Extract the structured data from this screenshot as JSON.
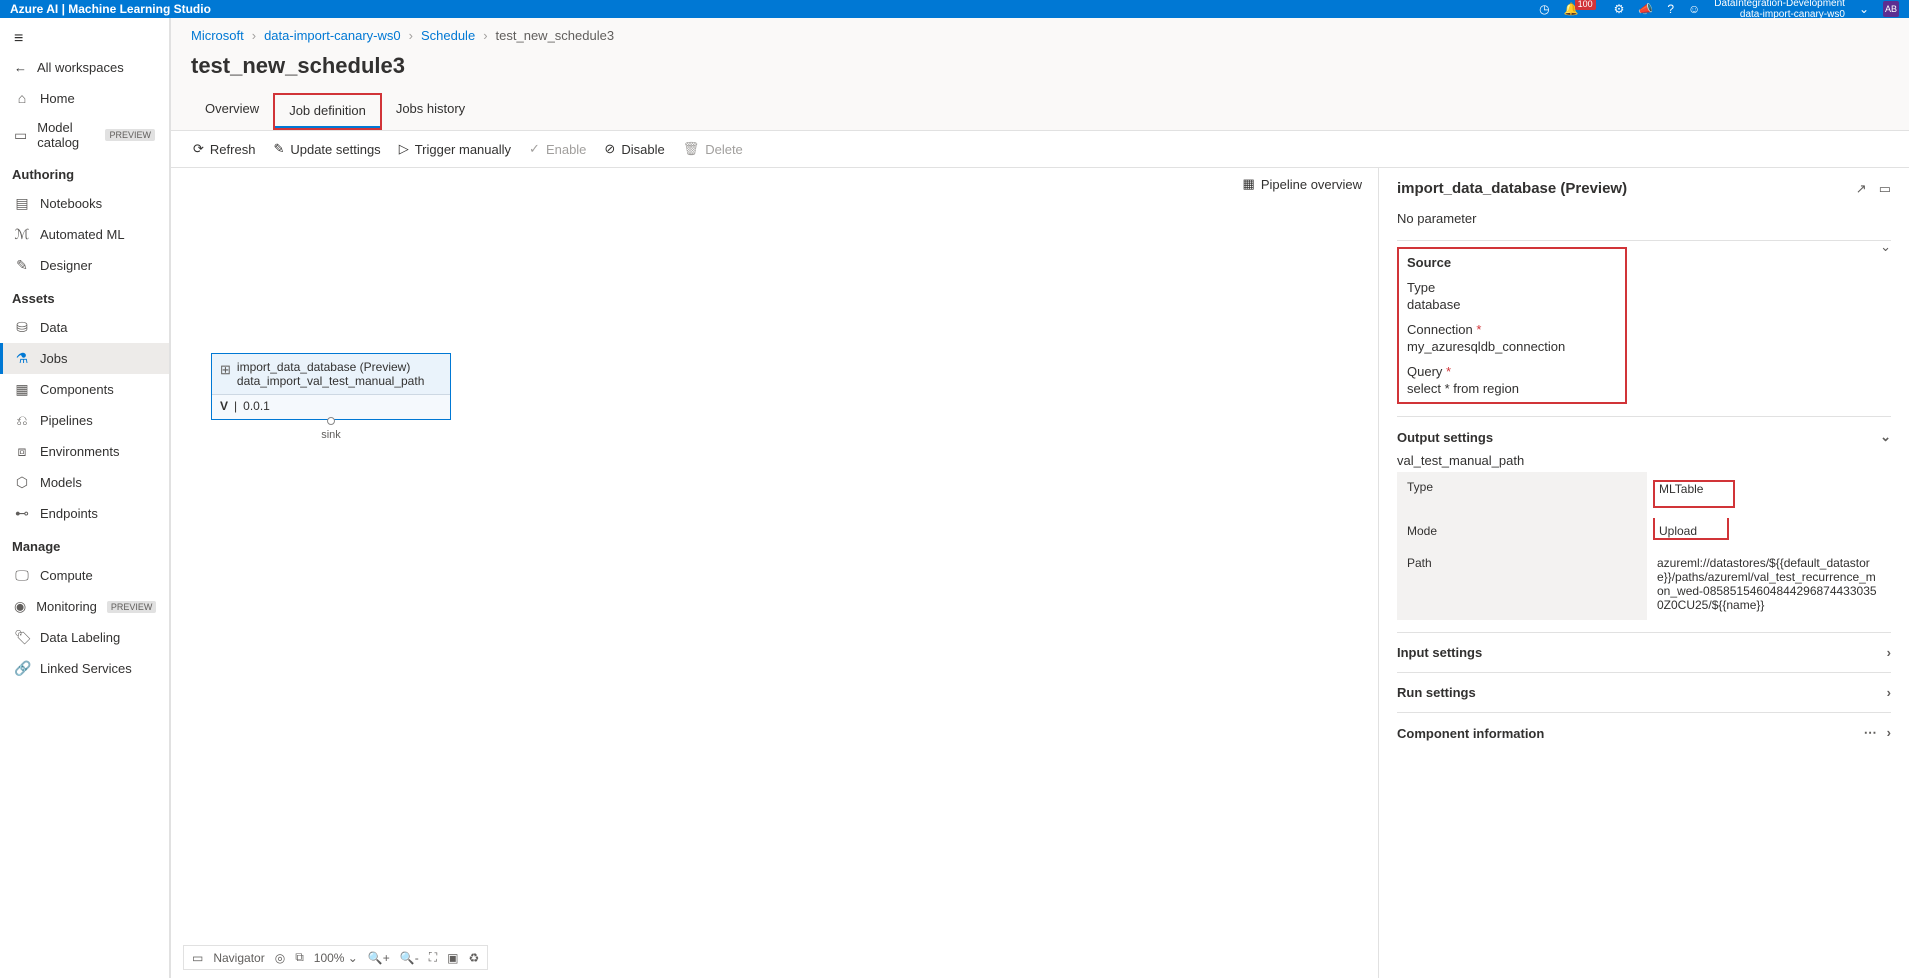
{
  "topbar": {
    "title": "Azure AI | Machine Learning Studio",
    "notif_count": "100",
    "workspace_line1": "DataIntegration-Development",
    "workspace_line2": "data-import-canary-ws0",
    "avatar": "AB"
  },
  "sidebar": {
    "all_workspaces": "All workspaces",
    "home": "Home",
    "model_catalog": "Model catalog",
    "preview": "PREVIEW",
    "sec_authoring": "Authoring",
    "notebooks": "Notebooks",
    "automl": "Automated ML",
    "designer": "Designer",
    "sec_assets": "Assets",
    "data": "Data",
    "jobs": "Jobs",
    "components": "Components",
    "pipelines": "Pipelines",
    "environments": "Environments",
    "models": "Models",
    "endpoints": "Endpoints",
    "sec_manage": "Manage",
    "compute": "Compute",
    "monitoring": "Monitoring",
    "datalabeling": "Data Labeling",
    "linkedservices": "Linked Services"
  },
  "breadcrumb": {
    "b1": "Microsoft",
    "b2": "data-import-canary-ws0",
    "b3": "Schedule",
    "b4": "test_new_schedule3"
  },
  "page_title": "test_new_schedule3",
  "tabs": {
    "overview": "Overview",
    "jobdef": "Job definition",
    "history": "Jobs history"
  },
  "toolbar": {
    "refresh": "Refresh",
    "update": "Update settings",
    "trigger": "Trigger manually",
    "enable": "Enable",
    "disable": "Disable",
    "delete": "Delete"
  },
  "canvas": {
    "pipeline_overview": "Pipeline overview",
    "node_title": "import_data_database (Preview)",
    "node_sub": "data_import_val_test_manual_path",
    "node_v": "V",
    "node_version": "0.0.1",
    "sink": "sink",
    "navigator": "Navigator",
    "zoom": "100%"
  },
  "rpanel": {
    "title": "import_data_database (Preview)",
    "no_param": "No parameter",
    "source": "Source",
    "type_label": "Type",
    "type_value": "database",
    "conn_label": "Connection",
    "conn_value": "my_azuresqldb_connection",
    "query_label": "Query",
    "query_value": "select * from region",
    "output_settings": "Output settings",
    "output_name": "val_test_manual_path",
    "out_type_l": "Type",
    "out_type_v": "MLTable",
    "out_mode_l": "Mode",
    "out_mode_v": "Upload",
    "out_path_l": "Path",
    "out_path_v": "azureml://datastores/${{default_datastore}}/paths/azureml/val_test_recurrence_mon_wed-085851546048442968744330350Z0CU25/${{name}}",
    "input_settings": "Input settings",
    "run_settings": "Run settings",
    "component_info": "Component information"
  }
}
